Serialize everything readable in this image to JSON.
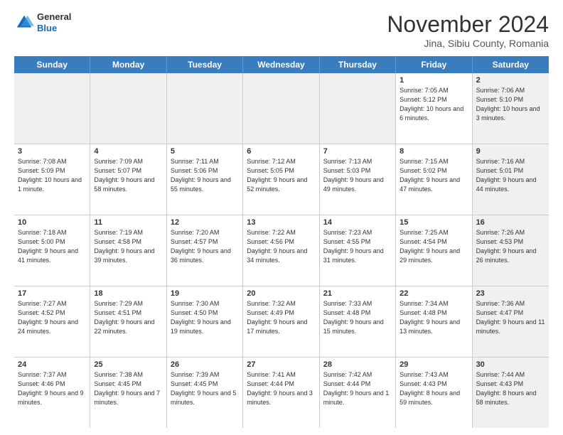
{
  "header": {
    "logo_general": "General",
    "logo_blue": "Blue",
    "title": "November 2024",
    "location": "Jina, Sibiu County, Romania"
  },
  "weekdays": [
    "Sunday",
    "Monday",
    "Tuesday",
    "Wednesday",
    "Thursday",
    "Friday",
    "Saturday"
  ],
  "rows": [
    [
      {
        "day": "",
        "info": "",
        "shaded": true
      },
      {
        "day": "",
        "info": "",
        "shaded": true
      },
      {
        "day": "",
        "info": "",
        "shaded": true
      },
      {
        "day": "",
        "info": "",
        "shaded": true
      },
      {
        "day": "",
        "info": "",
        "shaded": true
      },
      {
        "day": "1",
        "info": "Sunrise: 7:05 AM\nSunset: 5:12 PM\nDaylight: 10 hours\nand 6 minutes.",
        "shaded": false
      },
      {
        "day": "2",
        "info": "Sunrise: 7:06 AM\nSunset: 5:10 PM\nDaylight: 10 hours\nand 3 minutes.",
        "shaded": true
      }
    ],
    [
      {
        "day": "3",
        "info": "Sunrise: 7:08 AM\nSunset: 5:09 PM\nDaylight: 10 hours\nand 1 minute.",
        "shaded": false
      },
      {
        "day": "4",
        "info": "Sunrise: 7:09 AM\nSunset: 5:07 PM\nDaylight: 9 hours\nand 58 minutes.",
        "shaded": false
      },
      {
        "day": "5",
        "info": "Sunrise: 7:11 AM\nSunset: 5:06 PM\nDaylight: 9 hours\nand 55 minutes.",
        "shaded": false
      },
      {
        "day": "6",
        "info": "Sunrise: 7:12 AM\nSunset: 5:05 PM\nDaylight: 9 hours\nand 52 minutes.",
        "shaded": false
      },
      {
        "day": "7",
        "info": "Sunrise: 7:13 AM\nSunset: 5:03 PM\nDaylight: 9 hours\nand 49 minutes.",
        "shaded": false
      },
      {
        "day": "8",
        "info": "Sunrise: 7:15 AM\nSunset: 5:02 PM\nDaylight: 9 hours\nand 47 minutes.",
        "shaded": false
      },
      {
        "day": "9",
        "info": "Sunrise: 7:16 AM\nSunset: 5:01 PM\nDaylight: 9 hours\nand 44 minutes.",
        "shaded": true
      }
    ],
    [
      {
        "day": "10",
        "info": "Sunrise: 7:18 AM\nSunset: 5:00 PM\nDaylight: 9 hours\nand 41 minutes.",
        "shaded": false
      },
      {
        "day": "11",
        "info": "Sunrise: 7:19 AM\nSunset: 4:58 PM\nDaylight: 9 hours\nand 39 minutes.",
        "shaded": false
      },
      {
        "day": "12",
        "info": "Sunrise: 7:20 AM\nSunset: 4:57 PM\nDaylight: 9 hours\nand 36 minutes.",
        "shaded": false
      },
      {
        "day": "13",
        "info": "Sunrise: 7:22 AM\nSunset: 4:56 PM\nDaylight: 9 hours\nand 34 minutes.",
        "shaded": false
      },
      {
        "day": "14",
        "info": "Sunrise: 7:23 AM\nSunset: 4:55 PM\nDaylight: 9 hours\nand 31 minutes.",
        "shaded": false
      },
      {
        "day": "15",
        "info": "Sunrise: 7:25 AM\nSunset: 4:54 PM\nDaylight: 9 hours\nand 29 minutes.",
        "shaded": false
      },
      {
        "day": "16",
        "info": "Sunrise: 7:26 AM\nSunset: 4:53 PM\nDaylight: 9 hours\nand 26 minutes.",
        "shaded": true
      }
    ],
    [
      {
        "day": "17",
        "info": "Sunrise: 7:27 AM\nSunset: 4:52 PM\nDaylight: 9 hours\nand 24 minutes.",
        "shaded": false
      },
      {
        "day": "18",
        "info": "Sunrise: 7:29 AM\nSunset: 4:51 PM\nDaylight: 9 hours\nand 22 minutes.",
        "shaded": false
      },
      {
        "day": "19",
        "info": "Sunrise: 7:30 AM\nSunset: 4:50 PM\nDaylight: 9 hours\nand 19 minutes.",
        "shaded": false
      },
      {
        "day": "20",
        "info": "Sunrise: 7:32 AM\nSunset: 4:49 PM\nDaylight: 9 hours\nand 17 minutes.",
        "shaded": false
      },
      {
        "day": "21",
        "info": "Sunrise: 7:33 AM\nSunset: 4:48 PM\nDaylight: 9 hours\nand 15 minutes.",
        "shaded": false
      },
      {
        "day": "22",
        "info": "Sunrise: 7:34 AM\nSunset: 4:48 PM\nDaylight: 9 hours\nand 13 minutes.",
        "shaded": false
      },
      {
        "day": "23",
        "info": "Sunrise: 7:36 AM\nSunset: 4:47 PM\nDaylight: 9 hours\nand 11 minutes.",
        "shaded": true
      }
    ],
    [
      {
        "day": "24",
        "info": "Sunrise: 7:37 AM\nSunset: 4:46 PM\nDaylight: 9 hours\nand 9 minutes.",
        "shaded": false
      },
      {
        "day": "25",
        "info": "Sunrise: 7:38 AM\nSunset: 4:45 PM\nDaylight: 9 hours\nand 7 minutes.",
        "shaded": false
      },
      {
        "day": "26",
        "info": "Sunrise: 7:39 AM\nSunset: 4:45 PM\nDaylight: 9 hours\nand 5 minutes.",
        "shaded": false
      },
      {
        "day": "27",
        "info": "Sunrise: 7:41 AM\nSunset: 4:44 PM\nDaylight: 9 hours\nand 3 minutes.",
        "shaded": false
      },
      {
        "day": "28",
        "info": "Sunrise: 7:42 AM\nSunset: 4:44 PM\nDaylight: 9 hours\nand 1 minute.",
        "shaded": false
      },
      {
        "day": "29",
        "info": "Sunrise: 7:43 AM\nSunset: 4:43 PM\nDaylight: 8 hours\nand 59 minutes.",
        "shaded": false
      },
      {
        "day": "30",
        "info": "Sunrise: 7:44 AM\nSunset: 4:43 PM\nDaylight: 8 hours\nand 58 minutes.",
        "shaded": true
      }
    ]
  ]
}
